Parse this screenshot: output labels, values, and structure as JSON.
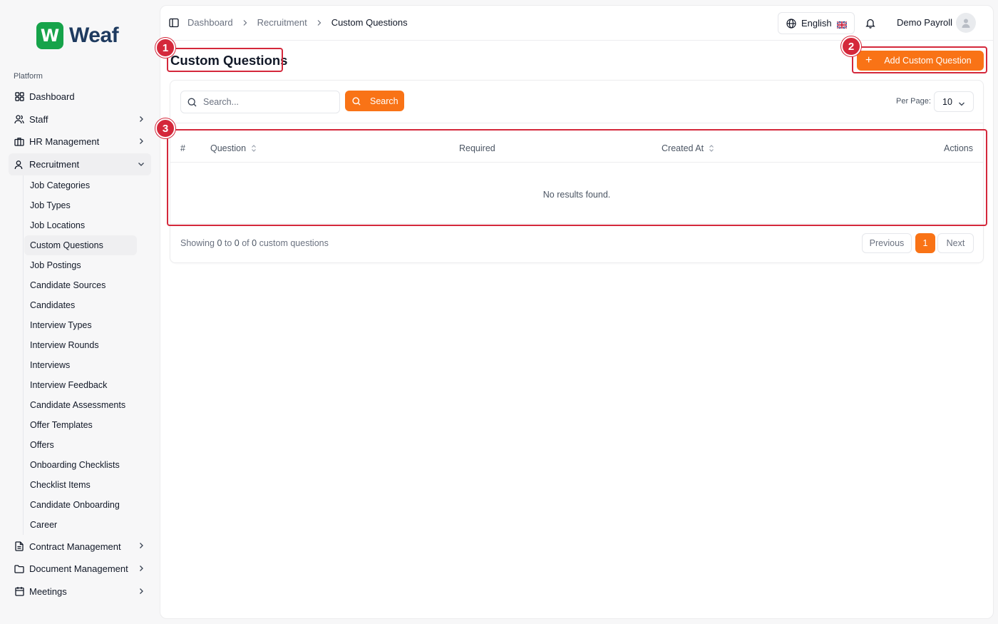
{
  "brand": {
    "logo_letter": "W",
    "name": "Weaf",
    "color": "#16a34a"
  },
  "sidebar": {
    "section_label": "Platform",
    "top_items": [
      {
        "label": "Dashboard",
        "icon": "layout-grid-icon"
      },
      {
        "label": "Staff",
        "icon": "users-icon",
        "has_chevron": true
      },
      {
        "label": "HR Management",
        "icon": "briefcase-icon",
        "has_chevron": true
      },
      {
        "label": "Recruitment",
        "icon": "user-search-icon",
        "expanded": true
      }
    ],
    "recruitment_items": [
      "Job Categories",
      "Job Types",
      "Job Locations",
      "Custom Questions",
      "Job Postings",
      "Candidate Sources",
      "Candidates",
      "Interview Types",
      "Interview Rounds",
      "Interviews",
      "Interview Feedback",
      "Candidate Assessments",
      "Offer Templates",
      "Offers",
      "Onboarding Checklists",
      "Checklist Items",
      "Candidate Onboarding",
      "Career"
    ],
    "active_subitem": "Custom Questions",
    "bottom_items": [
      {
        "label": "Contract Management",
        "icon": "file-text-icon"
      },
      {
        "label": "Document Management",
        "icon": "folder-icon"
      },
      {
        "label": "Meetings",
        "icon": "calendar-icon"
      }
    ]
  },
  "header": {
    "breadcrumbs": [
      "Dashboard",
      "Recruitment",
      "Custom Questions"
    ],
    "language": "English",
    "user_name": "Demo Payroll"
  },
  "page": {
    "title": "Custom Questions",
    "add_button": "Add Custom Question",
    "accent_color": "#f97316"
  },
  "search": {
    "placeholder": "Search...",
    "button_label": "Search",
    "per_page_label": "Per Page:",
    "per_page_value": "10"
  },
  "table": {
    "columns": [
      "#",
      "Question",
      "Required",
      "Created At",
      "Actions"
    ],
    "empty_text": "No results found."
  },
  "footer": {
    "showing_prefix": "Showing",
    "from": "0",
    "to_word": "to",
    "to": "0",
    "of_word": "of",
    "total": "0",
    "suffix": "custom questions",
    "prev_label": "Previous",
    "current_page": "1",
    "next_label": "Next"
  },
  "annotations": [
    "1",
    "2",
    "3"
  ],
  "annotation_color": "#d4283b"
}
